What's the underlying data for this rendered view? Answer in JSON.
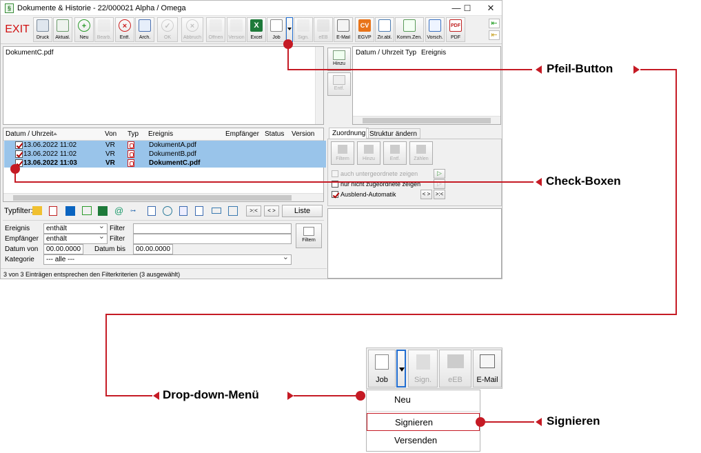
{
  "window": {
    "title": "Dokumente & Historie - 22/000021  Alpha / Omega",
    "controls": {
      "minimize": "—",
      "maximize": "☐",
      "close": "✕"
    }
  },
  "toolbar": {
    "exit": "EXIT",
    "buttons": [
      {
        "label": "Druck",
        "icon": "printer-icon",
        "enabled": true
      },
      {
        "label": "Aktual.",
        "icon": "refresh-icon",
        "enabled": true
      },
      {
        "label": "Neu",
        "icon": "plus-icon",
        "enabled": true
      },
      {
        "label": "Bearb.",
        "icon": "edit-icon",
        "enabled": false
      },
      {
        "label": "Entf.",
        "icon": "delete-icon",
        "enabled": true
      },
      {
        "label": "Arch.",
        "icon": "archive-icon",
        "enabled": true
      },
      {
        "label": "OK",
        "icon": "check-icon",
        "enabled": false
      },
      {
        "label": "Abbruch",
        "icon": "cancel-icon",
        "enabled": false
      },
      {
        "label": "Öffnen",
        "icon": "open-icon",
        "enabled": false
      },
      {
        "label": "Version",
        "icon": "version-icon",
        "enabled": false
      },
      {
        "label": "Excel",
        "icon": "excel-icon",
        "enabled": true
      },
      {
        "label": "Job",
        "icon": "job-icon",
        "enabled": true
      },
      {
        "label": "Sign.",
        "icon": "sign-icon",
        "enabled": false
      },
      {
        "label": "eEB",
        "icon": "eeb-icon",
        "enabled": false
      },
      {
        "label": "E-Mail",
        "icon": "email-icon",
        "enabled": true
      },
      {
        "label": "EGVP",
        "icon": "egvp-icon",
        "enabled": true
      },
      {
        "label": "Zir.abl.",
        "icon": "clipboard-icon",
        "enabled": true
      },
      {
        "label": "Komm.Zen.",
        "icon": "communication-icon",
        "enabled": true
      },
      {
        "label": "Vorsch.",
        "icon": "preview-icon",
        "enabled": true
      },
      {
        "label": "PDF",
        "icon": "pdf-icon",
        "enabled": true
      }
    ]
  },
  "preview": {
    "filename": "DokumentC.pdf"
  },
  "side_buttons": {
    "add": "Hinzu",
    "remove": "Entf."
  },
  "event_grid": {
    "headers": [
      "Datum / Uhrzeit",
      "Typ",
      "Ereignis"
    ]
  },
  "doc_table": {
    "headers": [
      "Datum / Uhrzeit",
      "Von",
      "Typ",
      "Ereignis",
      "Empfänger",
      "Status",
      "Version"
    ],
    "rows": [
      {
        "date": "13.06.2022  11:02",
        "from": "VR",
        "event": "DokumentA.pdf",
        "checked": true,
        "bold": false
      },
      {
        "date": "13.06.2022  11:02",
        "from": "VR",
        "event": "DokumentB.pdf",
        "checked": true,
        "bold": false
      },
      {
        "date": "13.06.2022  11:03",
        "from": "VR",
        "event": "DokumentC.pdf",
        "checked": true,
        "bold": true
      }
    ]
  },
  "typfilter": {
    "label": "Typfilter:",
    "collapse": ">:<",
    "expand": "< >",
    "list": "Liste"
  },
  "filter": {
    "ereignis_label": "Ereignis",
    "ereignis_op": "enthält",
    "empfaenger_label": "Empfänger",
    "empfaenger_op": "enthält",
    "filter_label": "Filter",
    "datum_von_label": "Datum von",
    "datum_von": "00.00.0000",
    "datum_bis_label": "Datum bis",
    "datum_bis": "00.00.0000",
    "kategorie_label": "Kategorie",
    "kategorie": "--- alle ---",
    "filter_button": "Filtern"
  },
  "status_bar": "3 von 3 Einträgen entsprechen den Filterkriterien (3 ausgewählt)",
  "zuordnung": {
    "tabs": [
      "Zuordnung",
      "Struktur ändern"
    ],
    "buttons": [
      "Filtern",
      "Hinzu",
      "Entf.",
      "Zählen"
    ],
    "options": [
      {
        "label": "auch untergeordnete zeigen",
        "checked": false,
        "enabled": false
      },
      {
        "label": "nur nicht zugeordnete zeigen",
        "checked": false,
        "enabled": true
      },
      {
        "label": "Ausblend-Automatik",
        "checked": true,
        "enabled": true
      }
    ],
    "expand": "< >",
    "collapse": ">:<"
  },
  "annotations": {
    "arrow_button": "Pfeil-Button",
    "check_boxes": "Check-Boxen",
    "dropdown_menu": "Drop-down-Menü",
    "sign": "Signieren"
  },
  "zoom": {
    "buttons": [
      {
        "label": "Job",
        "enabled": true
      },
      {
        "label": "Sign.",
        "enabled": false
      },
      {
        "label": "eEB",
        "enabled": false
      },
      {
        "label": "E-Mail",
        "enabled": true
      }
    ],
    "menu": [
      "Neu",
      "Signieren",
      "Versenden"
    ]
  },
  "colors": {
    "accent": "#c51a24",
    "selection": "#99c4ea",
    "exit": "#d01010"
  }
}
